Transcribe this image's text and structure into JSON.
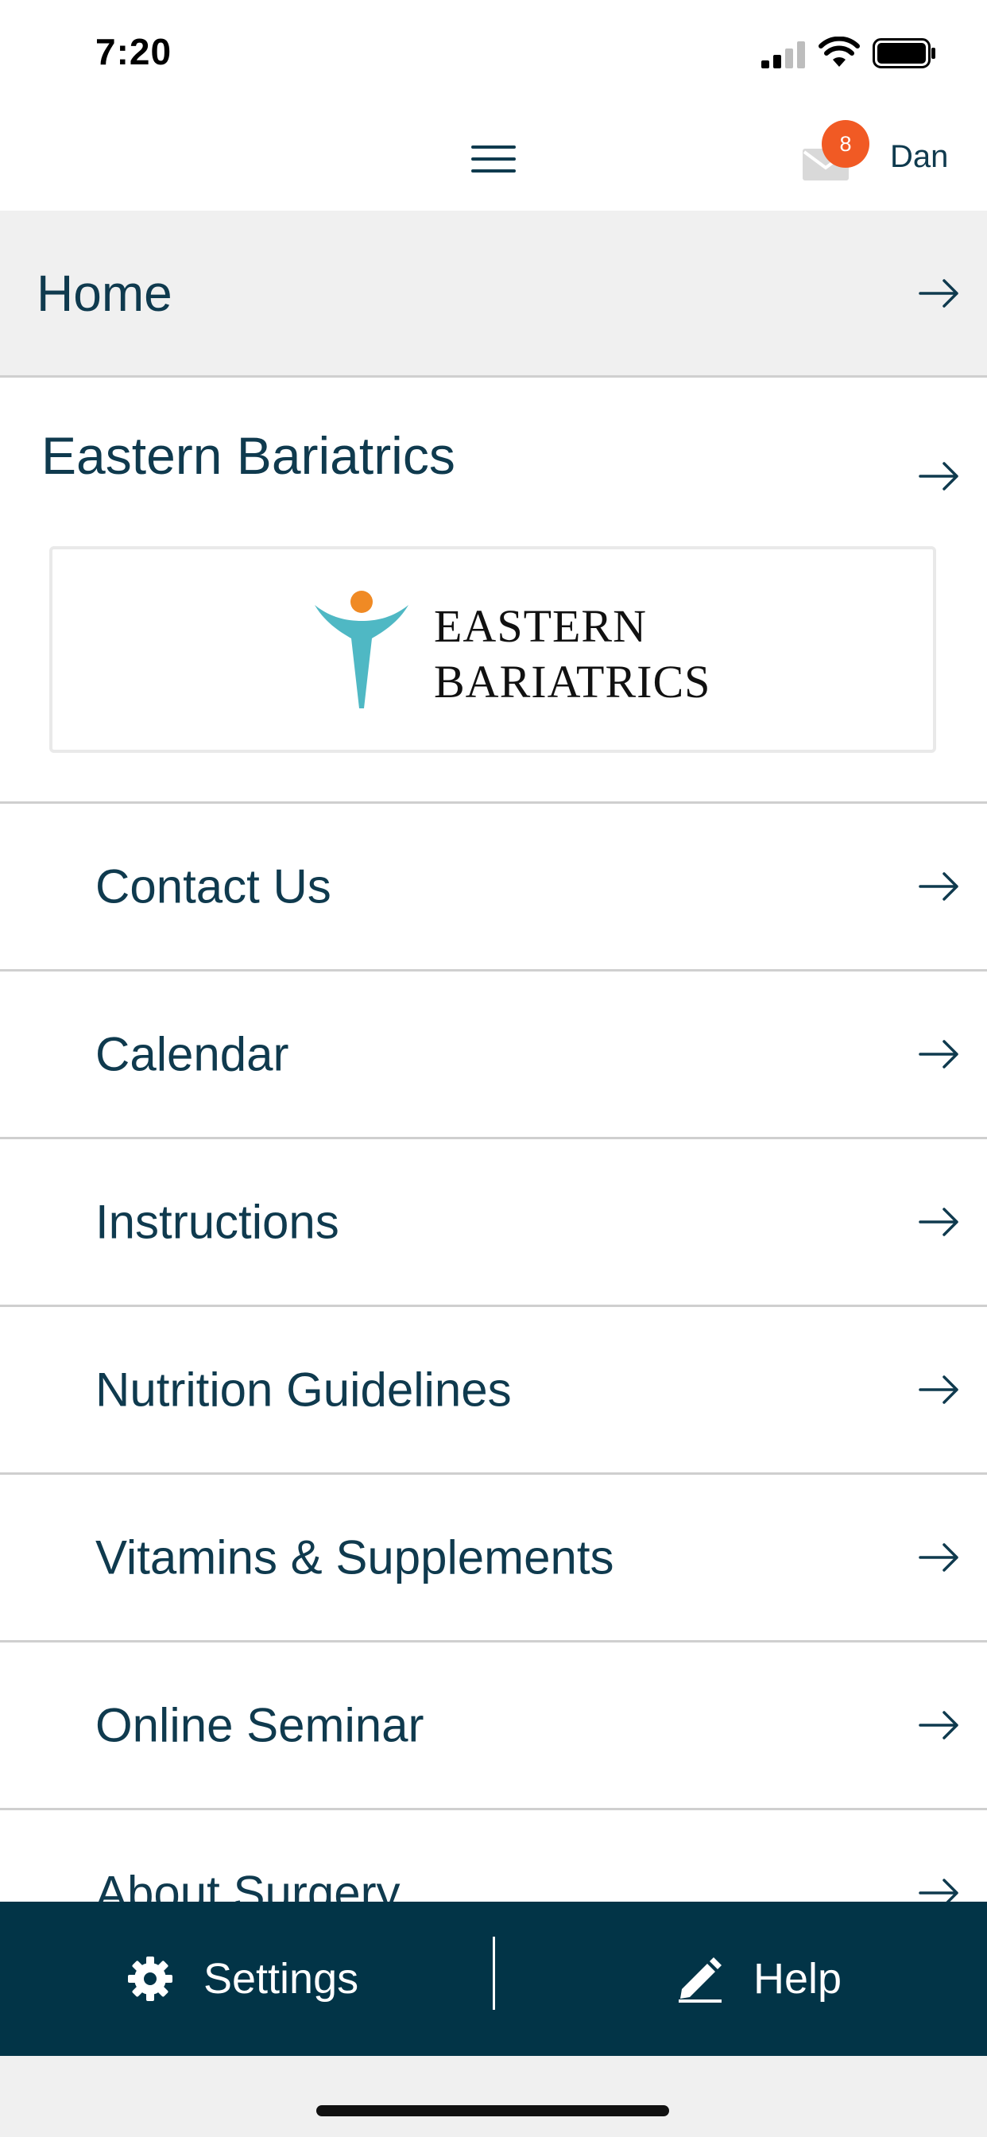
{
  "status_bar": {
    "time": "7:20"
  },
  "header": {
    "badge_count": "8",
    "user_name": "Dan"
  },
  "nav": {
    "home_label": "Home",
    "practice": {
      "title": "Eastern Bariatrics",
      "logo_line1": "EASTERN",
      "logo_line2": "BARIATRICS"
    },
    "items": [
      {
        "label": "Contact Us"
      },
      {
        "label": "Calendar"
      },
      {
        "label": "Instructions"
      },
      {
        "label": "Nutrition Guidelines"
      },
      {
        "label": "Vitamins & Supplements"
      },
      {
        "label": "Online Seminar"
      },
      {
        "label": "About Surgery"
      }
    ]
  },
  "bottom_bar": {
    "settings_label": "Settings",
    "help_label": "Help"
  },
  "icons": {
    "menu": "hamburger-icon",
    "mail": "envelope-icon",
    "row_arrow": "arrow-right-icon",
    "settings": "gear-icon",
    "help": "pencil-icon"
  },
  "colors": {
    "text": "#0f3a4e",
    "badge": "#f15a24",
    "bottom_bar": "#023447",
    "home_row_bg": "#f0f0f0",
    "logo_teal": "#4fb8c4",
    "logo_orange": "#f08a24"
  }
}
